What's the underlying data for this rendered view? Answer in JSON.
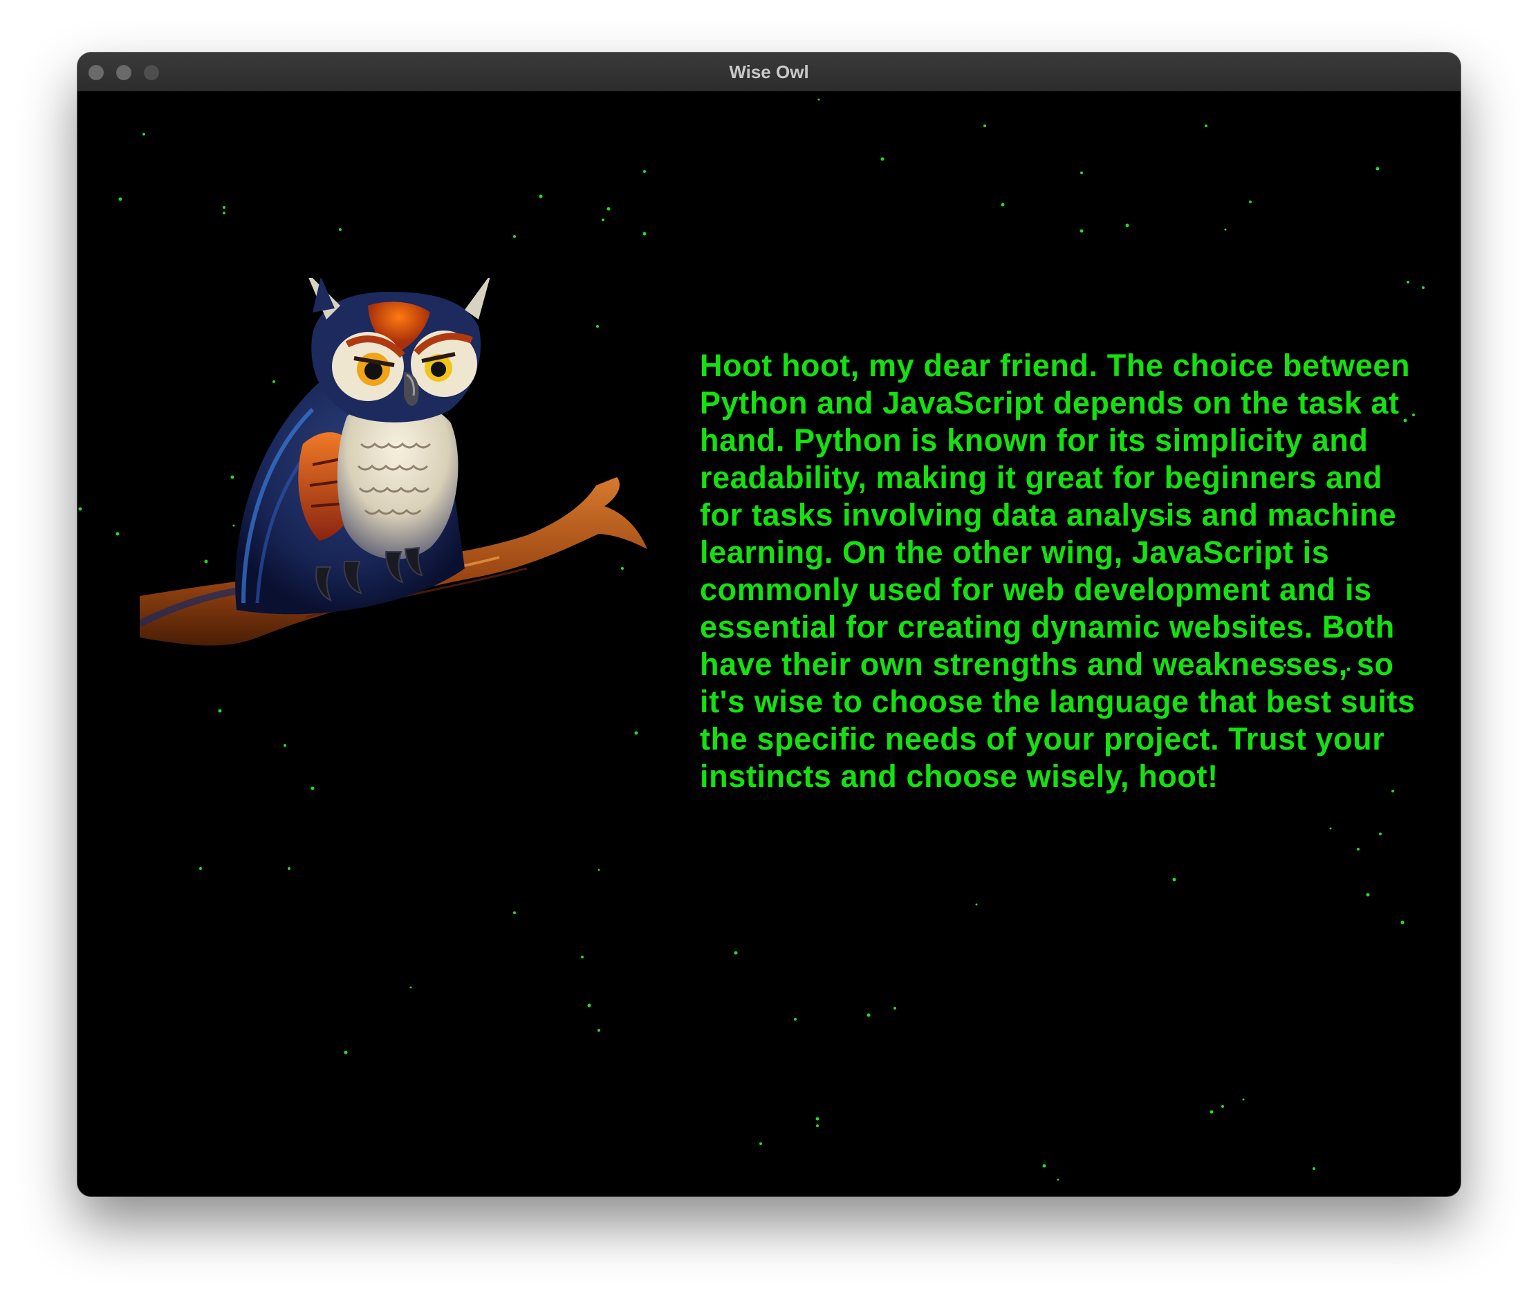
{
  "window": {
    "title": "Wise Owl",
    "controls": [
      "close",
      "minimize",
      "maximize"
    ]
  },
  "main": {
    "image": {
      "icon": "owl-on-branch-illustration"
    },
    "message": "Hoot hoot, my dear friend. The choice between Python and JavaScript depends on the task at hand. Python is known for its simplicity and readability, making it great for beginners and for tasks involving data analysis and machine learning. On the other wing, JavaScript is commonly used for web development and is essential for creating dynamic websites. Both have their own strengths and weaknesses, so it's wise to choose the language that best suits the specific needs of your project. Trust your instincts and choose wisely, hoot!"
  },
  "colors": {
    "background": "#000000",
    "text": "#15e010",
    "stars": "#22dd22",
    "titlebar": "#2f2f2f"
  }
}
